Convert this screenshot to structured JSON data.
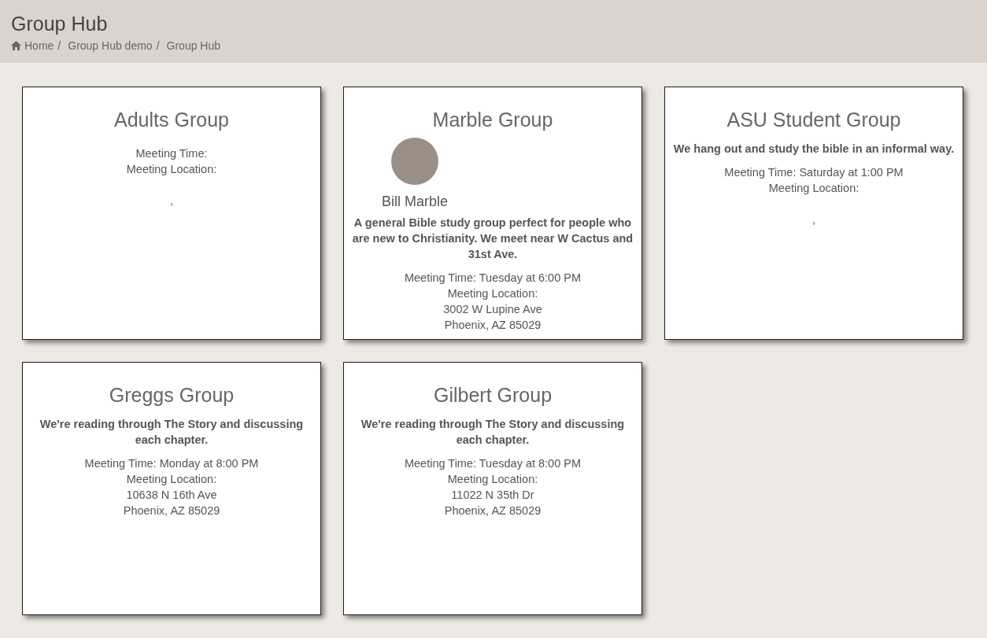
{
  "header": {
    "title": "Group Hub",
    "breadcrumbs": [
      "Home",
      "Group Hub demo",
      "Group Hub"
    ],
    "separator": "/"
  },
  "groups": [
    {
      "name": "Adults Group",
      "meeting_time": "Meeting Time:",
      "meeting_location": "Meeting Location:",
      "city_line": ","
    },
    {
      "name": "Marble Group",
      "leader": {
        "name": "Bill Marble"
      },
      "description": "A general Bible study group perfect for people who are new to Christianity. We meet near W Cactus and 31st Ave.",
      "meeting_time": "Meeting Time: Tuesday at 6:00 PM",
      "meeting_location": "Meeting Location:",
      "street": "3002 W Lupine Ave",
      "city_line": "Phoenix, AZ 85029"
    },
    {
      "name": "ASU Student Group",
      "description": "We hang out and study the bible in an informal way.",
      "meeting_time": "Meeting Time: Saturday at 1:00 PM",
      "meeting_location": "Meeting Location:",
      "city_line": ","
    },
    {
      "name": "Greggs Group",
      "description": "We're reading through The Story and discussing each chapter.",
      "meeting_time": "Meeting Time: Monday at 8:00 PM",
      "meeting_location": "Meeting Location:",
      "street": "10638 N 16th Ave",
      "city_line": "Phoenix, AZ 85029"
    },
    {
      "name": "Gilbert Group",
      "description": "We're reading through The Story and discussing each chapter.",
      "meeting_time": "Meeting Time: Tuesday at 8:00 PM",
      "meeting_location": "Meeting Location:",
      "street": "11022 N 35th Dr",
      "city_line": "Phoenix, AZ 85029"
    }
  ]
}
